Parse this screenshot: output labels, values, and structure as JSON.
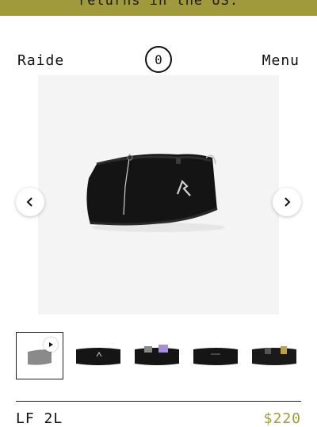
{
  "banner": {
    "text": "returns in the US."
  },
  "header": {
    "logo": "Raide",
    "cart_count": "0",
    "menu_label": "Menu"
  },
  "gallery": {
    "thumbnail_count": 5,
    "active_index": 0
  },
  "product": {
    "name": "LF 2L",
    "price": "$220"
  },
  "colors": {
    "accent": "#a19a3d",
    "image_bg": "#f4f4f4"
  }
}
